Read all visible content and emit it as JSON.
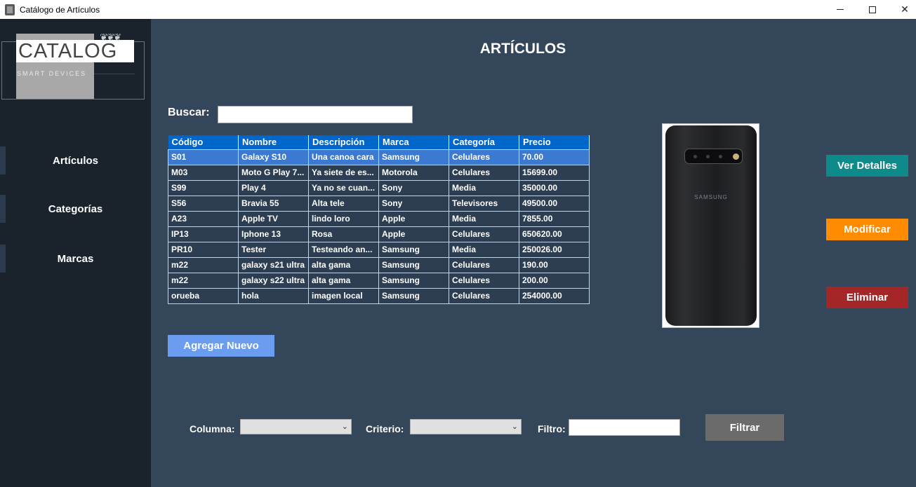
{
  "window": {
    "title": "Catálogo de Artículos"
  },
  "logo": {
    "title": "CATALOG",
    "subtitle": "SMART DEVICES"
  },
  "sidebar": {
    "items": [
      {
        "label": "Artículos"
      },
      {
        "label": "Categorías"
      },
      {
        "label": "Marcas"
      }
    ]
  },
  "main": {
    "title": "ARTÍCULOS"
  },
  "search": {
    "label": "Buscar:",
    "value": ""
  },
  "grid": {
    "columns": [
      "Código",
      "Nombre",
      "Descripción",
      "Marca",
      "Categoría",
      "Precio"
    ],
    "rows": [
      [
        "S01",
        "Galaxy S10",
        "Una canoa cara",
        "Samsung",
        "Celulares",
        "70.00"
      ],
      [
        "M03",
        "Moto G Play 7...",
        "Ya siete de es...",
        "Motorola",
        "Celulares",
        "15699.00"
      ],
      [
        "S99",
        "Play 4",
        "Ya no se cuan...",
        "Sony",
        "Media",
        "35000.00"
      ],
      [
        "S56",
        "Bravia 55",
        "Alta tele",
        "Sony",
        "Televisores",
        "49500.00"
      ],
      [
        "A23",
        "Apple TV",
        "lindo loro",
        "Apple",
        "Media",
        "7855.00"
      ],
      [
        "IP13",
        "Iphone 13",
        "Rosa",
        "Apple",
        "Celulares",
        "650620.00"
      ],
      [
        "PR10",
        "Tester",
        "Testeando an...",
        "Samsung",
        "Media",
        "250026.00"
      ],
      [
        "m22",
        "galaxy s21 ultra",
        "alta gama",
        "Samsung",
        "Celulares",
        "190.00"
      ],
      [
        "m22",
        "galaxy s22 ultra",
        "alta gama",
        "Samsung",
        "Celulares",
        "200.00"
      ],
      [
        "orueba",
        "hola",
        "imagen local",
        "Samsung",
        "Celulares",
        "254000.00"
      ]
    ],
    "selected_row": 0
  },
  "buttons": {
    "add": "Agregar Nuevo",
    "details": "Ver Detalles",
    "modify": "Modificar",
    "delete": "Eliminar",
    "filter": "Filtrar"
  },
  "filter": {
    "column_label": "Columna:",
    "criteria_label": "Criterio:",
    "filter_label": "Filtro:",
    "column_value": "",
    "criteria_value": "",
    "filter_value": ""
  },
  "image": {
    "brand": "SAMSUNG"
  },
  "icons": {
    "minimize": "minimize-icon",
    "maximize": "maximize-icon",
    "close": "close-icon",
    "dropdown": "chevron-down-icon"
  }
}
